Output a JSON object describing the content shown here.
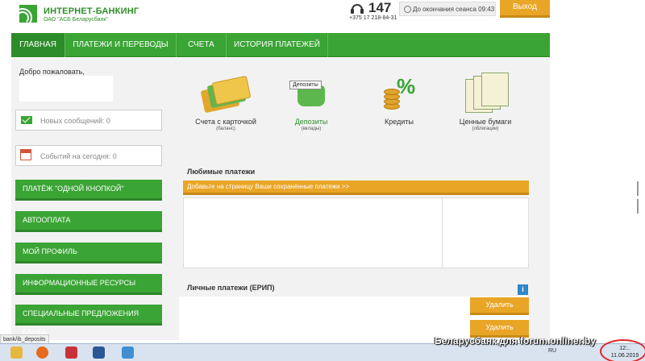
{
  "header": {
    "logo_title": "ИНТЕРНЕТ-БАНКИНГ",
    "logo_subtitle": "ОАО \"АСБ Беларусбанк\"",
    "short_phone": "147",
    "long_phone": "+375 17 218-84-31",
    "session_text": "До окончания сеанса 09:43",
    "logout_label": "Выход"
  },
  "nav": {
    "tabs": [
      {
        "label": "ГЛАВНАЯ"
      },
      {
        "label": "ПЛАТЕЖИ И ПЕРЕВОДЫ"
      },
      {
        "label": "СЧЕТА"
      },
      {
        "label": "ИСТОРИЯ ПЛАТЕЖЕЙ"
      }
    ]
  },
  "sidebar": {
    "welcome": "Добро пожаловать,",
    "messages": "Новых сообщений: 0",
    "events": "Событий на сегодня: 0",
    "buttons": [
      {
        "label": "ПЛАТЁЖ \"ОДНОЙ КНОПКОЙ\""
      },
      {
        "label": "АВТООПЛАТА"
      },
      {
        "label": "МОЙ ПРОФИЛЬ"
      },
      {
        "label": "ИНФОРМАЦИОННЫЕ РЕСУРСЫ"
      },
      {
        "label": "СПЕЦИАЛЬНЫЕ ПРЕДЛОЖЕНИЯ БАНКА"
      }
    ]
  },
  "products": [
    {
      "label": "Счета с карточкой",
      "sub": "(баланс)"
    },
    {
      "label": "Депозиты",
      "sub": "(вклады)",
      "tooltip": "Депозиты"
    },
    {
      "label": "Кредиты",
      "sub": ""
    },
    {
      "label": "Ценные бумаги",
      "sub": "(облигации)"
    }
  ],
  "favorites": {
    "title": "Любимые платежи",
    "bar_text": "Добавьте на страницу Ваши сохранённые платежи >>"
  },
  "erip": {
    "title": "Личные платежи (ЕРИП)",
    "info_label": "i",
    "delete_label": "Удалить"
  },
  "status_url": "bank/ib_deposits",
  "taskbar": {
    "lang": "RU",
    "time": "12:..",
    "date": "11.06.2019"
  },
  "watermark": "Беларусбанк для forum.onliner.by",
  "colors": {
    "brand_green": "#3aa435",
    "accent_orange": "#e9a526",
    "info_blue": "#2f86c9",
    "highlight_red": "#e0262b"
  }
}
